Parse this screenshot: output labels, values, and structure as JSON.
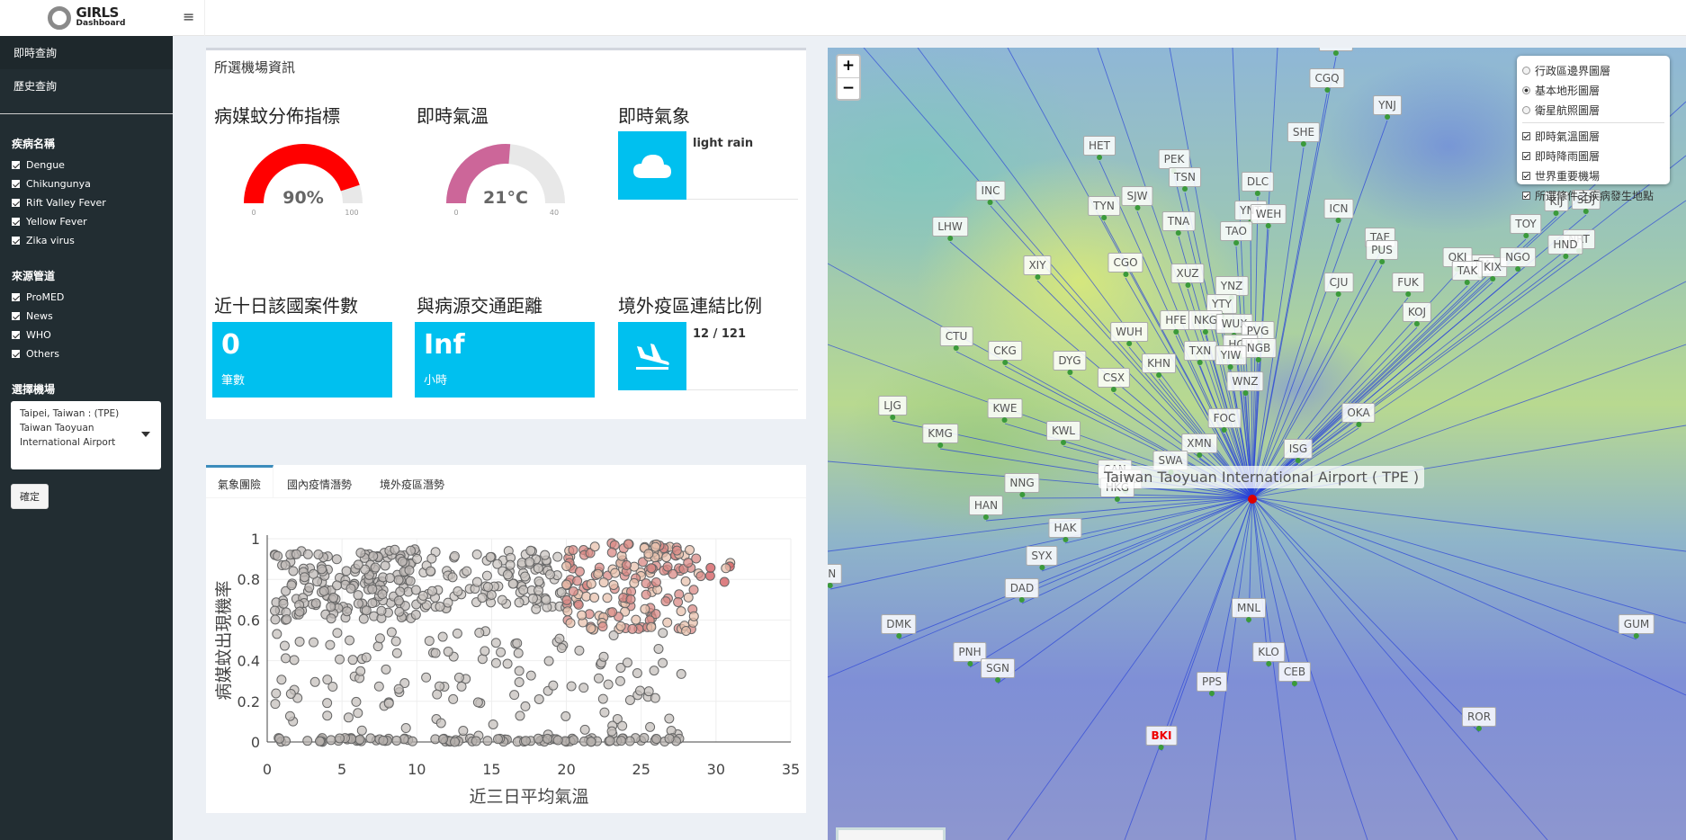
{
  "app": {
    "logo_main": "GIRLS",
    "logo_sub": "Dashboard",
    "menu_icon": "hamburger-icon"
  },
  "sidebar": {
    "nav": [
      {
        "label": "即時查詢"
      },
      {
        "label": "歷史查詢"
      }
    ],
    "disease_title": "疾病名稱",
    "diseases": [
      "Dengue",
      "Chikungunya",
      "Rift Valley Fever",
      "Yellow Fever",
      "Zika virus"
    ],
    "source_title": "來源管道",
    "sources": [
      "ProMED",
      "News",
      "WHO",
      "Others"
    ],
    "airport_title": "選擇機場",
    "airport_selected": "Taipei, Taiwan : (TPE) Taiwan Taoyuan International Airport",
    "confirm_label": "確定"
  },
  "info": {
    "box_title": "所選機場資訊",
    "mosquito": {
      "title": "病媒蚊分佈指標",
      "value": 90,
      "display": "90%",
      "min": "0",
      "max": "100",
      "color": "#ff0000"
    },
    "temperature": {
      "title": "即時氣溫",
      "value": 21,
      "display": "21°C",
      "min": "0",
      "max": "40",
      "color": "#cc6699"
    },
    "weather": {
      "title": "即時氣象",
      "text": "light rain",
      "icon": "cloud-icon"
    },
    "cases": {
      "title": "近十日該國案件數",
      "value": "0",
      "unit": "筆數"
    },
    "distance": {
      "title": "與病源交通距離",
      "value": "Inf",
      "unit": "小時"
    },
    "links": {
      "title": "境外疫區連結比例",
      "text": "12 / 121",
      "icon": "plane-landing-icon"
    }
  },
  "tabs": [
    "氣象團險",
    "國內疫情潛勢",
    "境外疫區潛勢"
  ],
  "chart_data": {
    "type": "scatter",
    "title": "",
    "xlabel": "近三日平均氣溫",
    "ylabel": "病媒蚊出現機率",
    "xlim": [
      0,
      35
    ],
    "ylim": [
      0,
      1
    ],
    "xticks": [
      "0",
      "5",
      "10",
      "15",
      "20",
      "25",
      "30",
      "35"
    ],
    "yticks": [
      "0",
      "0.2",
      "0.4",
      "0.6",
      "0.8",
      "1"
    ],
    "points_note": "approx. 700 points; grey for low temperature, shading to red above 20",
    "point_clusters": [
      {
        "x_range": [
          0.5,
          10
        ],
        "y_range": [
          0.6,
          0.95
        ],
        "n": 170,
        "color": "#bdb8b5"
      },
      {
        "x_range": [
          10,
          20
        ],
        "y_range": [
          0.65,
          0.95
        ],
        "n": 110,
        "color": "#c9c4c0"
      },
      {
        "x_range": [
          20,
          29
        ],
        "y_range": [
          0.55,
          0.98
        ],
        "n": 170,
        "color": "#d98a86"
      },
      {
        "x_range": [
          0.5,
          28
        ],
        "y_range": [
          0,
          0.55
        ],
        "n": 140,
        "color": "#c5c0bc"
      },
      {
        "x_range": [
          0.5,
          28
        ],
        "y_range": [
          0,
          0.02
        ],
        "n": 90,
        "color": "#b5b0ac"
      },
      {
        "x_range": [
          29,
          31
        ],
        "y_range": [
          0.78,
          0.9
        ],
        "n": 6,
        "color": "#d2555a"
      }
    ]
  },
  "map": {
    "zoom_in": "+",
    "zoom_out": "−",
    "base_layers": [
      {
        "label": "行政區邊界圖層",
        "on": false
      },
      {
        "label": "基本地形圖層",
        "on": true
      },
      {
        "label": "衛星航照圖層",
        "on": false
      }
    ],
    "overlays": [
      "即時氣溫圖層",
      "即時降雨圖層",
      "世界重要機場",
      "所選條件之疾病發生地點"
    ],
    "main_airport": "Taiwan Taoyuan International Airport ( TPE )",
    "airports": [
      "KHG",
      "CGQ",
      "YNJ",
      "SHE",
      "HET",
      "PEK",
      "TSN",
      "DLC",
      "INC",
      "TYN",
      "SJW",
      "YNT",
      "WEH",
      "ICN",
      "LHW",
      "TNA",
      "TAO",
      "TAE",
      "PUS",
      "TOY",
      "KIJ",
      "SDJ",
      "NRT",
      "HND",
      "XIY",
      "CGO",
      "XUZ",
      "FUK",
      "CJU",
      "ITM",
      "OKJ",
      "KIX",
      "NGO",
      "TAK",
      "YNZ",
      "YTY",
      "HFE",
      "NKG",
      "WUX",
      "PVG",
      "CTU",
      "WUH",
      "HGH",
      "NGB",
      "CKG",
      "DYG",
      "KHN",
      "TXN",
      "YIW",
      "CSX",
      "WNZ",
      "KOJ",
      "OKA",
      "LJG",
      "KWE",
      "FOC",
      "KMG",
      "KWL",
      "XMN",
      "ISG",
      "CAN",
      "SWA",
      "NNG",
      "SZX",
      "HKG",
      "HAN",
      "HAK",
      "SYX",
      "DAD",
      "MNL",
      "DMK",
      "GUM",
      "KLO",
      "PNH",
      "SGN",
      "CEB",
      "PPS",
      "ROR",
      "BKI",
      "IN"
    ]
  }
}
